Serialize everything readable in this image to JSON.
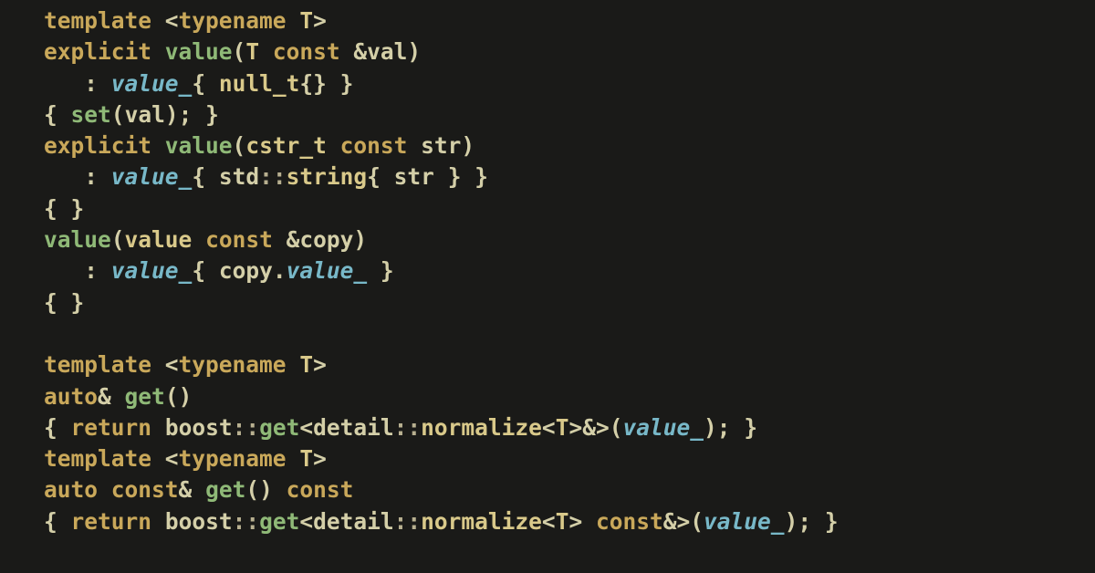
{
  "tokens": {
    "template": "template",
    "typename": "typename",
    "T": "T",
    "explicit": "explicit",
    "value_fn": "value",
    "const": "const",
    "amp": "&",
    "val": "val",
    "value_member": "value_",
    "null_t": "null_t",
    "set": "set",
    "cstr_t": "cstr_t",
    "str": "str",
    "std": "std",
    "string": "string",
    "copy": "copy",
    "auto": "auto",
    "get": "get",
    "return": "return",
    "boost": "boost",
    "detail": "detail",
    "normalize": "normalize",
    "lt": "<",
    "gt": ">",
    "lparen": "(",
    "rparen": ")",
    "lbrace": "{",
    "rbrace": "}",
    "colon": ":",
    "dcolon": "::",
    "semi": ";",
    "dot": ".",
    "sp": " ",
    "sp3": "   ",
    "amp2": "&"
  }
}
